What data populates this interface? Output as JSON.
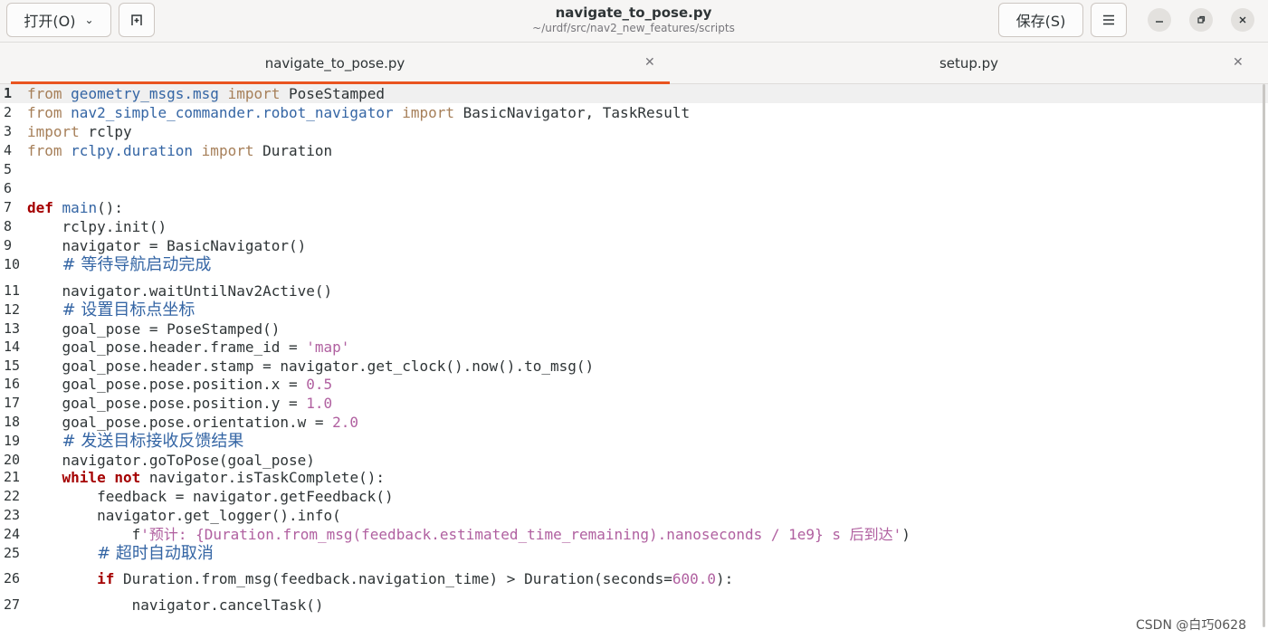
{
  "header": {
    "open_label": "打开(O)",
    "new_tab_icon": "new-tab-icon",
    "title": "navigate_to_pose.py",
    "subtitle": "~/urdf/src/nav2_new_features/scripts",
    "save_label": "保存(S)",
    "menu_icon": "hamburger-menu-icon"
  },
  "tabs": [
    {
      "label": "navigate_to_pose.py",
      "active": true
    },
    {
      "label": "setup.py",
      "active": false
    }
  ],
  "colors": {
    "accent": "#e95420",
    "keyword": "#a67f59",
    "bold_keyword": "#a50000",
    "module": "#3465a4",
    "string": "#b060a0"
  },
  "editor": {
    "current_line": 1,
    "lines": [
      {
        "n": "1",
        "text": "from geometry_msgs.msg import PoseStamped"
      },
      {
        "n": "2",
        "text": "from nav2_simple_commander.robot_navigator import BasicNavigator, TaskResult"
      },
      {
        "n": "3",
        "text": "import rclpy"
      },
      {
        "n": "4",
        "text": "from rclpy.duration import Duration"
      },
      {
        "n": "5",
        "text": ""
      },
      {
        "n": "6",
        "text": ""
      },
      {
        "n": "7",
        "text": "def main():"
      },
      {
        "n": "8",
        "text": "    rclpy.init()"
      },
      {
        "n": "9",
        "text": "    navigator = BasicNavigator()"
      },
      {
        "n": "10",
        "text": "    # 等待导航启动完成"
      },
      {
        "n": "11",
        "text": "    navigator.waitUntilNav2Active()"
      },
      {
        "n": "12",
        "text": "    # 设置目标点坐标"
      },
      {
        "n": "13",
        "text": "    goal_pose = PoseStamped()"
      },
      {
        "n": "14",
        "text": "    goal_pose.header.frame_id = 'map'"
      },
      {
        "n": "15",
        "text": "    goal_pose.header.stamp = navigator.get_clock().now().to_msg()"
      },
      {
        "n": "16",
        "text": "    goal_pose.pose.position.x = 0.5"
      },
      {
        "n": "17",
        "text": "    goal_pose.pose.position.y = 1.0"
      },
      {
        "n": "18",
        "text": "    goal_pose.pose.orientation.w = 2.0"
      },
      {
        "n": "19",
        "text": "    # 发送目标接收反馈结果"
      },
      {
        "n": "20",
        "text": "    navigator.goToPose(goal_pose)"
      },
      {
        "n": "21",
        "text": "    while not navigator.isTaskComplete():"
      },
      {
        "n": "22",
        "text": "        feedback = navigator.getFeedback()"
      },
      {
        "n": "23",
        "text": "        navigator.get_logger().info("
      },
      {
        "n": "24",
        "text": "            f'预计: {Duration.from_msg(feedback.estimated_time_remaining).nanoseconds / 1e9} s 后到达')"
      },
      {
        "n": "25",
        "text": "        # 超时自动取消"
      },
      {
        "n": "26",
        "text": "        if Duration.from_msg(feedback.navigation_time) > Duration(seconds=600.0):"
      },
      {
        "n": "27",
        "text": "            navigator.cancelTask()"
      }
    ]
  },
  "watermark": "CSDN @白巧0628"
}
